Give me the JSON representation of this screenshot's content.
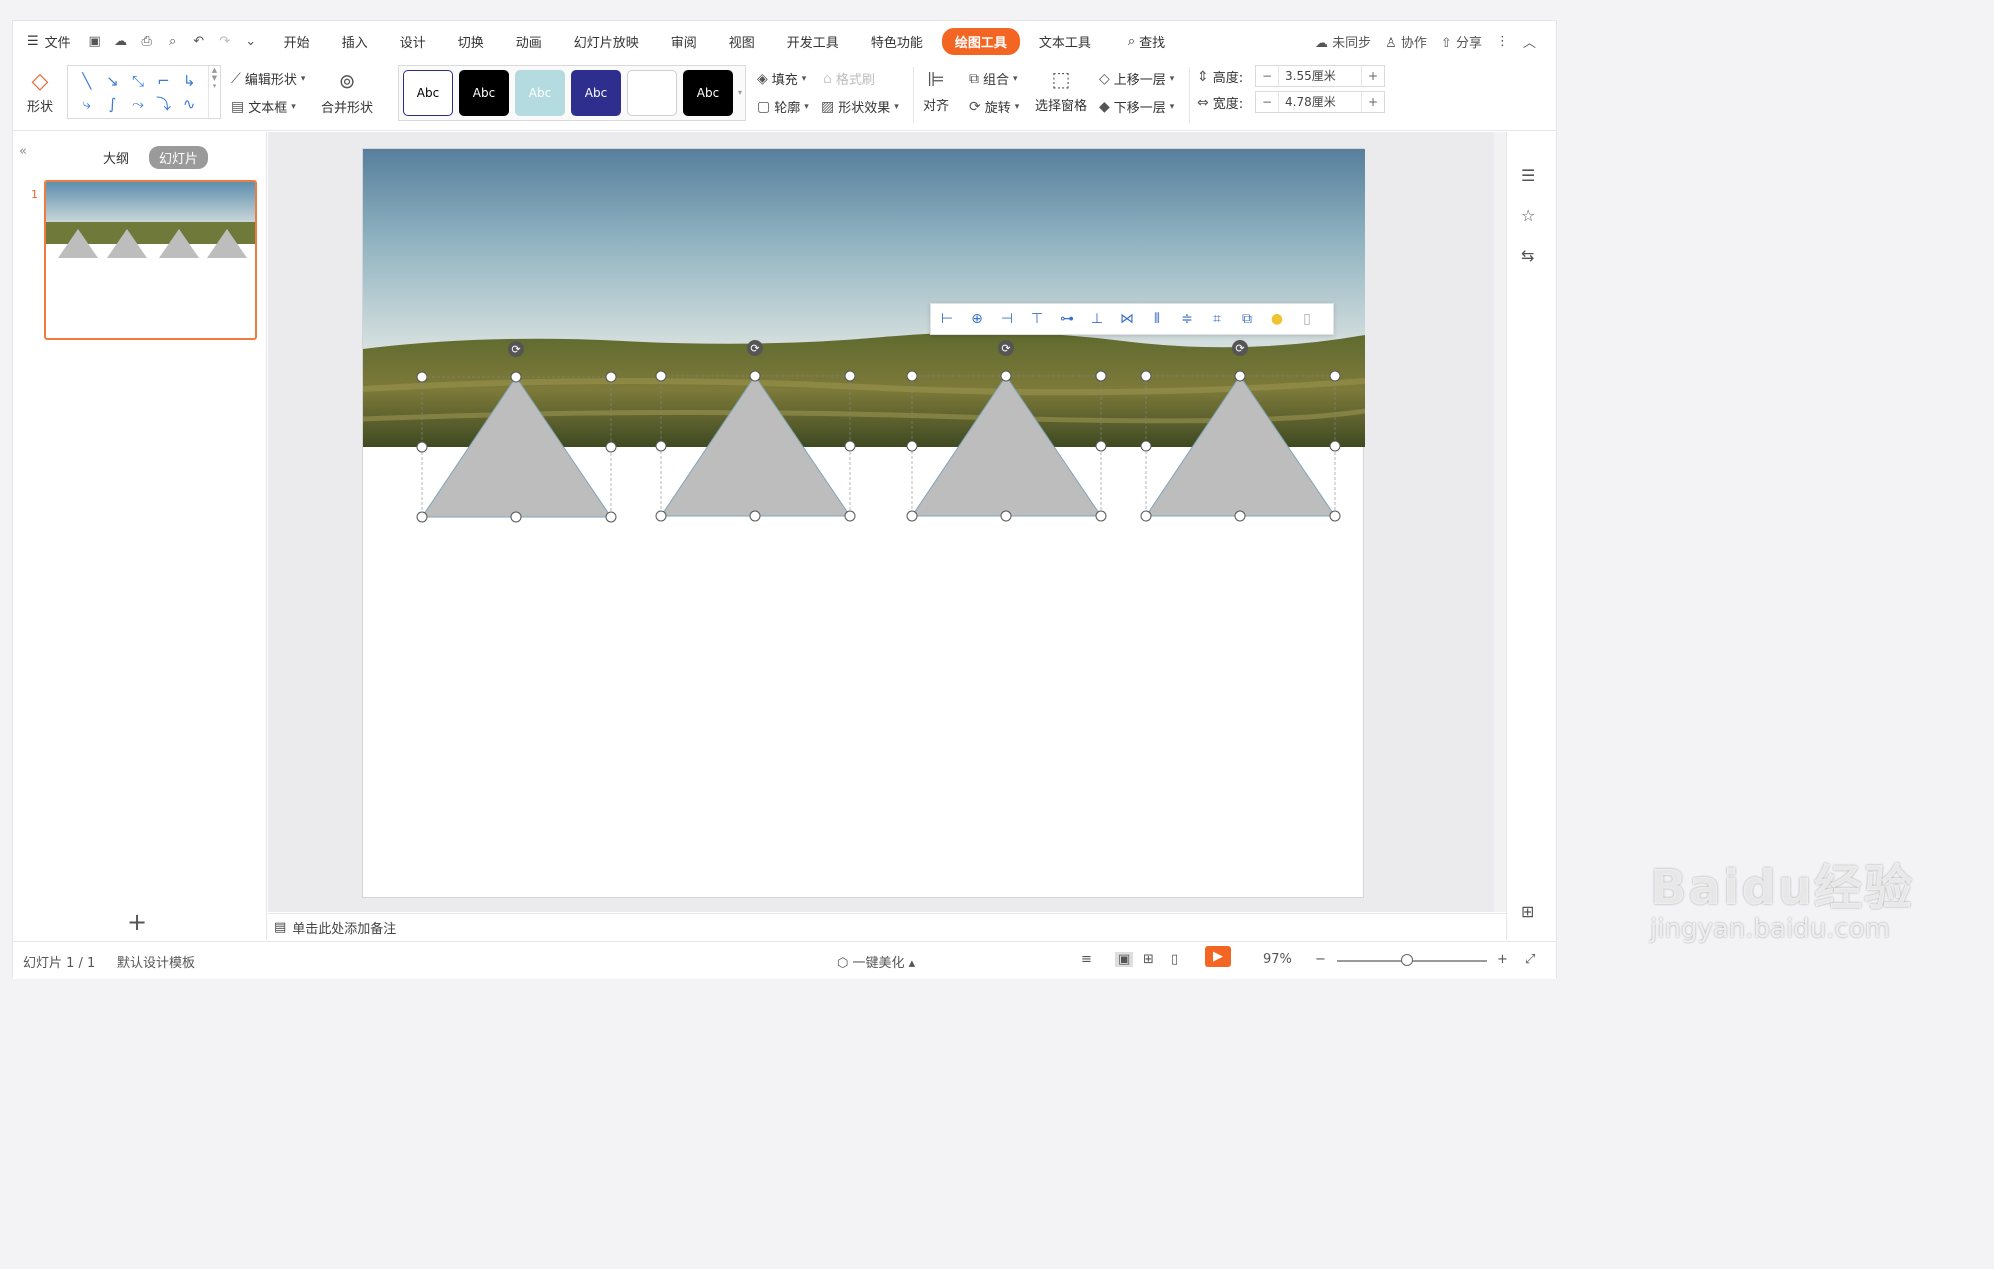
{
  "menu": {
    "file": "文件",
    "tabs": [
      "开始",
      "插入",
      "设计",
      "切换",
      "动画",
      "幻灯片放映",
      "审阅",
      "视图",
      "开发工具",
      "特色功能",
      "绘图工具",
      "文本工具"
    ],
    "active_tab": "绘图工具",
    "search": "查找",
    "right": {
      "sync": "未同步",
      "collab": "协作",
      "share": "分享"
    }
  },
  "ribbon": {
    "shape": "形状",
    "edit_shape": "编辑形状",
    "textbox": "文本框",
    "merge_shape": "合并形状",
    "style_swatches": [
      {
        "label": "Abc",
        "bg": "#ffffff",
        "fg": "#000000",
        "border": "#2b2b8a"
      },
      {
        "label": "Abc",
        "bg": "#000000",
        "fg": "#ffffff",
        "border": "#000000"
      },
      {
        "label": "Abc",
        "bg": "#b4dbe0",
        "fg": "#ffffff",
        "border": "#b4dbe0"
      },
      {
        "label": "Abc",
        "bg": "#2e2e8f",
        "fg": "#ffffff",
        "border": "#2e2e8f"
      },
      {
        "label": "",
        "bg": "#ffffff",
        "fg": "#000000",
        "border": "#d0d0d0"
      },
      {
        "label": "Abc",
        "bg": "#000000",
        "fg": "#ffffff",
        "border": "#000000"
      }
    ],
    "fill": "填充",
    "format_painter": "格式刷",
    "outline": "轮廓",
    "shape_effect": "形状效果",
    "align": "对齐",
    "group": "组合",
    "rotate": "旋转",
    "selection_pane": "选择窗格",
    "bring_forward": "上移一层",
    "send_backward": "下移一层",
    "height_label": "高度:",
    "height_value": "3.55厘米",
    "width_label": "宽度:",
    "width_value": "4.78厘米"
  },
  "left_panel": {
    "outline_tab": "大纲",
    "slides_tab": "幻灯片",
    "slide_number": "1"
  },
  "notes": {
    "placeholder": "单击此处添加备注"
  },
  "status": {
    "slide_info": "幻灯片 1 / 1",
    "template": "默认设计模板",
    "beautify": "一键美化",
    "zoom": "97%"
  },
  "watermark": {
    "brand": "Baidu经验",
    "url": "jingyan.baidu.com"
  },
  "colors": {
    "accent": "#f26522",
    "triangle": "#bdbdbd",
    "selection_blue": "#3b6fc9"
  }
}
